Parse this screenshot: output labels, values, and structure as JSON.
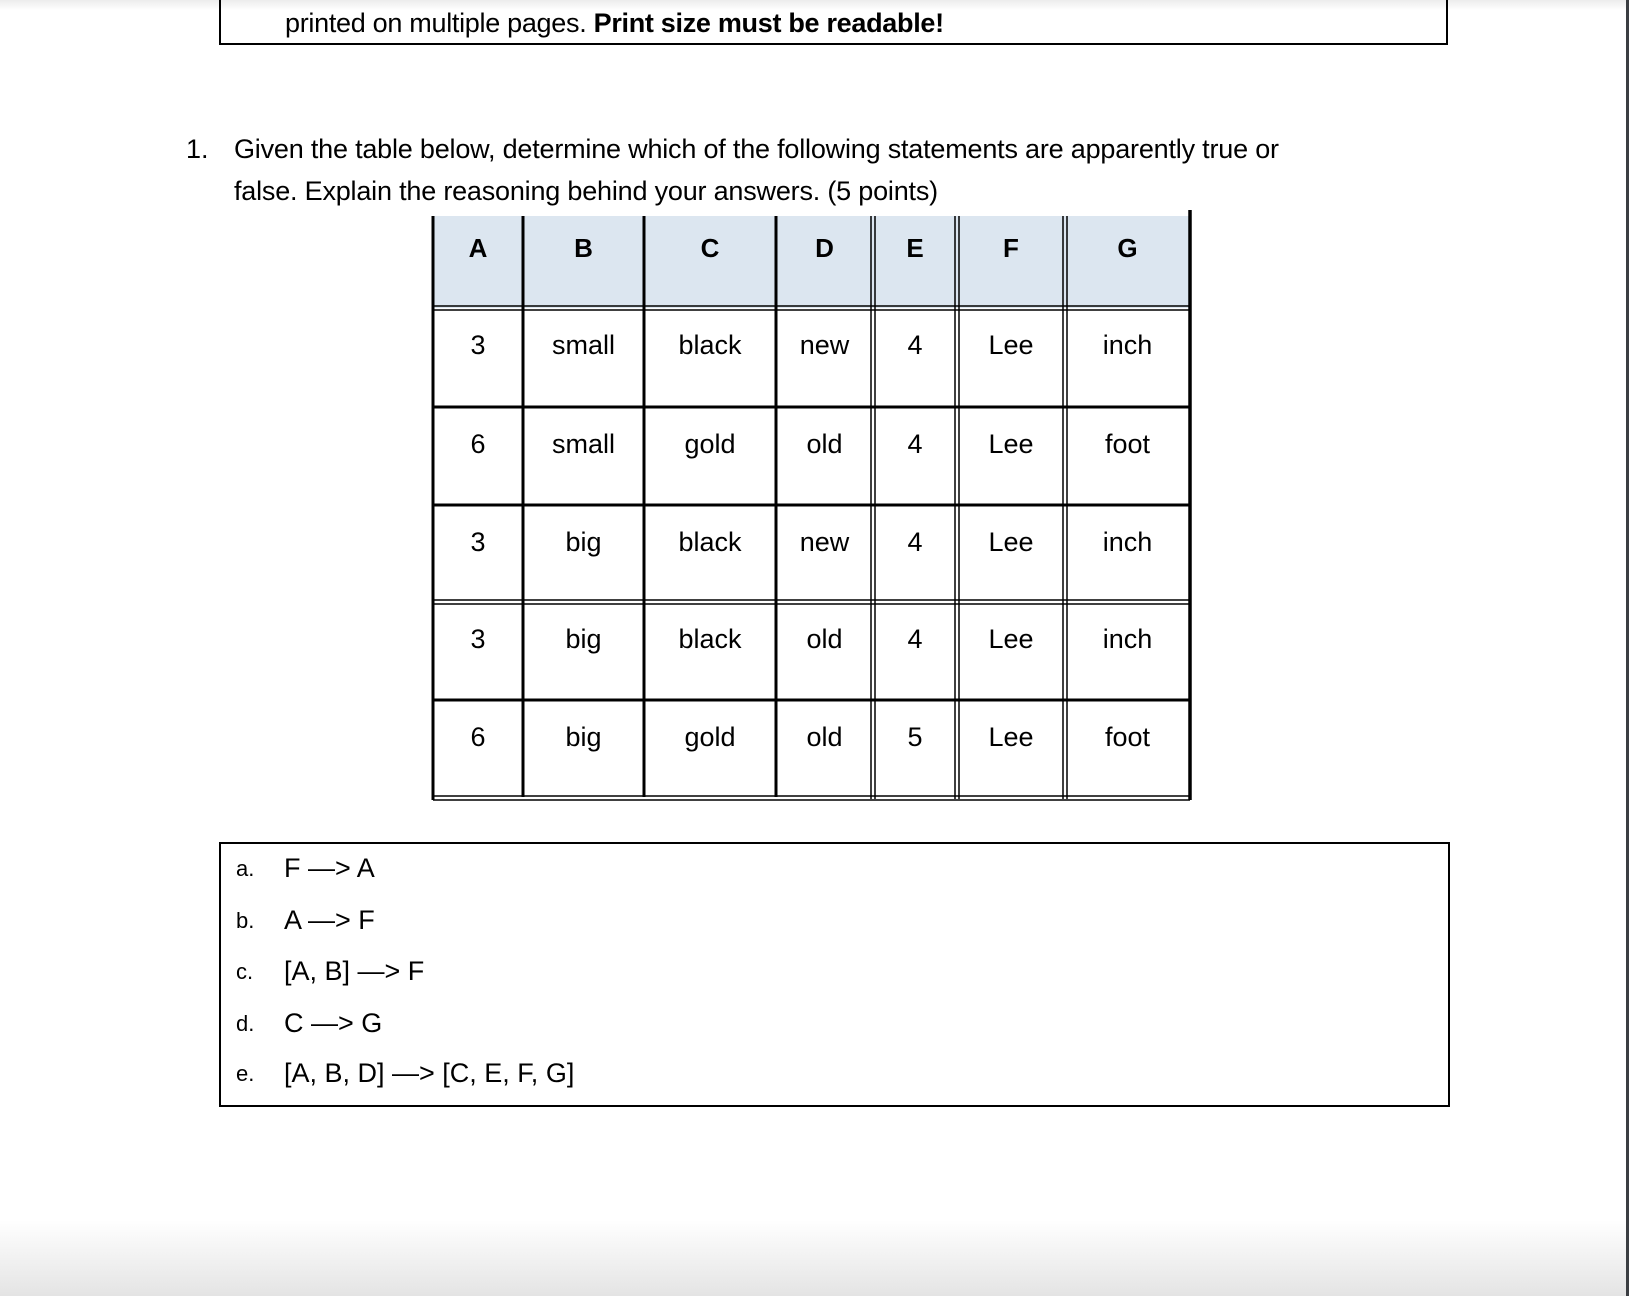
{
  "top_box": {
    "text_normal": "printed on multiple pages. ",
    "text_bold": "Print size must be readable!"
  },
  "question": {
    "number": "1.",
    "line1": "Given the table below, determine which of the following statements are apparently true or",
    "line2": "false.  Explain the reasoning behind your answers. (5 points)"
  },
  "table": {
    "header_bg": "#dce6f0",
    "columns": [
      "A",
      "B",
      "C",
      "D",
      "E",
      "F",
      "G"
    ],
    "rows": [
      [
        "3",
        "small",
        "black",
        "new",
        "4",
        "Lee",
        "inch"
      ],
      [
        "6",
        "small",
        "gold",
        "old",
        "4",
        "Lee",
        "foot"
      ],
      [
        "3",
        "big",
        "black",
        "new",
        "4",
        "Lee",
        "inch"
      ],
      [
        "3",
        "big",
        "black",
        "old",
        "4",
        "Lee",
        "inch"
      ],
      [
        "6",
        "big",
        "gold",
        "old",
        "5",
        "Lee",
        "foot"
      ]
    ]
  },
  "statements": [
    {
      "letter": "a.",
      "text": "F —> A"
    },
    {
      "letter": "b.",
      "text": "A —> F"
    },
    {
      "letter": "c.",
      "text": "[A, B] —> F"
    },
    {
      "letter": "d.",
      "text": "C —> G"
    },
    {
      "letter": "e.",
      "text": "[A, B, D] —> [C, E, F, G]"
    }
  ]
}
